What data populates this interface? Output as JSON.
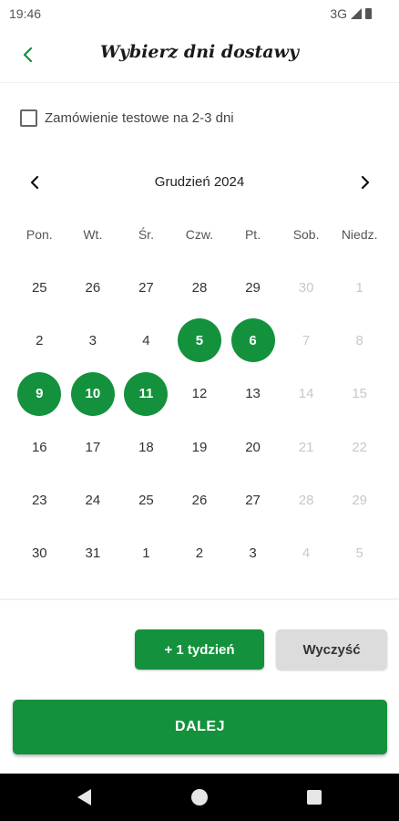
{
  "status_bar": {
    "time": "19:46",
    "network": "3G",
    "icons": [
      "signal-icon",
      "battery-icon"
    ]
  },
  "header": {
    "title": "Wybierz dni dostawy",
    "back_icon": "chevron-left-icon"
  },
  "test_order": {
    "label": "Zamówienie testowe na 2-3 dni",
    "checked": false
  },
  "calendar": {
    "month_label": "Grudzień 2024",
    "prev_icon": "chevron-left-icon",
    "next_icon": "chevron-right-icon",
    "weekdays": [
      "Pon.",
      "Wt.",
      "Śr.",
      "Czw.",
      "Pt.",
      "Sob.",
      "Niedz."
    ],
    "weeks": [
      [
        {
          "d": "25",
          "m": false
        },
        {
          "d": "26",
          "m": false
        },
        {
          "d": "27",
          "m": false
        },
        {
          "d": "28",
          "m": false
        },
        {
          "d": "29",
          "m": false
        },
        {
          "d": "30",
          "m": true
        },
        {
          "d": "1",
          "m": true
        }
      ],
      [
        {
          "d": "2",
          "m": false
        },
        {
          "d": "3",
          "m": false
        },
        {
          "d": "4",
          "m": false
        },
        {
          "d": "5",
          "m": false,
          "s": true
        },
        {
          "d": "6",
          "m": false,
          "s": true
        },
        {
          "d": "7",
          "m": true
        },
        {
          "d": "8",
          "m": true
        }
      ],
      [
        {
          "d": "9",
          "m": false,
          "s": true
        },
        {
          "d": "10",
          "m": false,
          "s": true
        },
        {
          "d": "11",
          "m": false,
          "s": true
        },
        {
          "d": "12",
          "m": false
        },
        {
          "d": "13",
          "m": false
        },
        {
          "d": "14",
          "m": true
        },
        {
          "d": "15",
          "m": true
        }
      ],
      [
        {
          "d": "16",
          "m": false
        },
        {
          "d": "17",
          "m": false
        },
        {
          "d": "18",
          "m": false
        },
        {
          "d": "19",
          "m": false
        },
        {
          "d": "20",
          "m": false
        },
        {
          "d": "21",
          "m": true
        },
        {
          "d": "22",
          "m": true
        }
      ],
      [
        {
          "d": "23",
          "m": false
        },
        {
          "d": "24",
          "m": false
        },
        {
          "d": "25",
          "m": false
        },
        {
          "d": "26",
          "m": false
        },
        {
          "d": "27",
          "m": false
        },
        {
          "d": "28",
          "m": true
        },
        {
          "d": "29",
          "m": true
        }
      ],
      [
        {
          "d": "30",
          "m": false
        },
        {
          "d": "31",
          "m": false
        },
        {
          "d": "1",
          "m": false
        },
        {
          "d": "2",
          "m": false
        },
        {
          "d": "3",
          "m": false
        },
        {
          "d": "4",
          "m": true
        },
        {
          "d": "5",
          "m": true
        }
      ]
    ]
  },
  "actions": {
    "add_week_label": "+ 1 tydzień",
    "clear_label": "Wyczyść",
    "next_label": "DALEJ"
  },
  "colors": {
    "accent": "#14913d",
    "secondary_button": "#dcdcdc",
    "muted_text": "#c8c8c8"
  },
  "system_nav": {
    "icons": [
      "back-triangle-icon",
      "home-circle-icon",
      "recents-square-icon"
    ]
  }
}
